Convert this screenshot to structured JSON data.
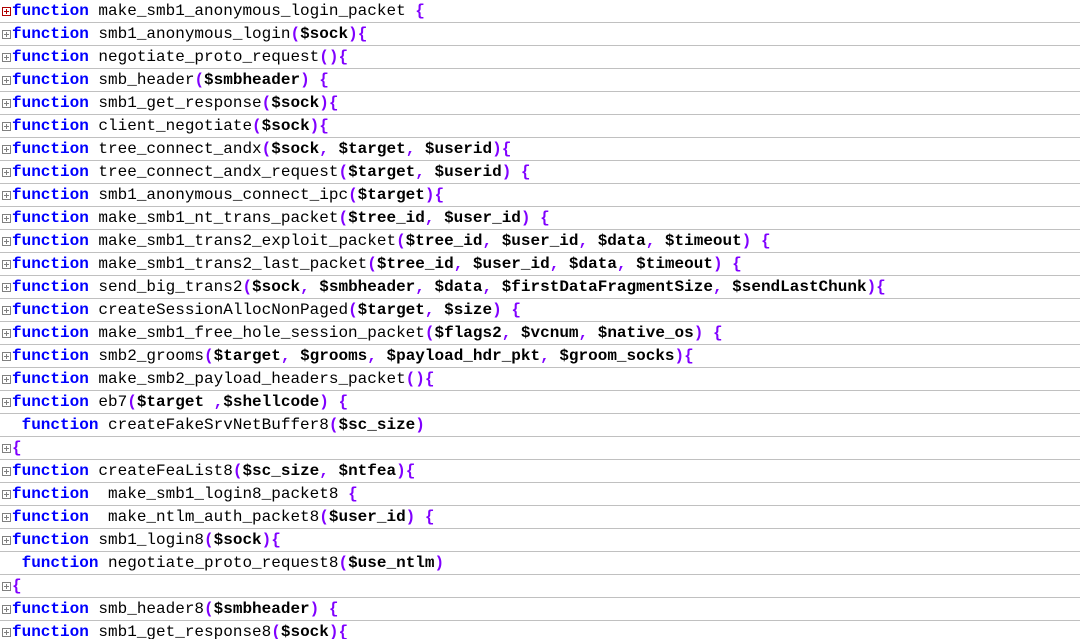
{
  "lines": [
    {
      "fold": "red",
      "tokens": [
        {
          "cls": "kw",
          "t": "function"
        },
        {
          "cls": "name",
          "t": " make_smb1_anonymous_login_packet "
        },
        {
          "cls": "brace",
          "t": "{"
        }
      ]
    },
    {
      "fold": "gray",
      "tokens": [
        {
          "cls": "kw",
          "t": "function"
        },
        {
          "cls": "name",
          "t": " smb1_anonymous_login"
        },
        {
          "cls": "punct",
          "t": "("
        },
        {
          "cls": "var",
          "t": "$sock"
        },
        {
          "cls": "punct",
          "t": ")"
        },
        {
          "cls": "brace",
          "t": "{"
        }
      ]
    },
    {
      "fold": "gray",
      "tokens": [
        {
          "cls": "kw",
          "t": "function"
        },
        {
          "cls": "name",
          "t": " negotiate_proto_request"
        },
        {
          "cls": "punct",
          "t": "()"
        },
        {
          "cls": "brace",
          "t": "{"
        }
      ]
    },
    {
      "fold": "gray",
      "tokens": [
        {
          "cls": "kw",
          "t": "function"
        },
        {
          "cls": "name",
          "t": " smb_header"
        },
        {
          "cls": "punct",
          "t": "("
        },
        {
          "cls": "var",
          "t": "$smbheader"
        },
        {
          "cls": "punct",
          "t": ") "
        },
        {
          "cls": "brace",
          "t": "{"
        }
      ]
    },
    {
      "fold": "gray",
      "tokens": [
        {
          "cls": "kw",
          "t": "function"
        },
        {
          "cls": "name",
          "t": " smb1_get_response"
        },
        {
          "cls": "punct",
          "t": "("
        },
        {
          "cls": "var",
          "t": "$sock"
        },
        {
          "cls": "punct",
          "t": ")"
        },
        {
          "cls": "brace",
          "t": "{"
        }
      ]
    },
    {
      "fold": "gray",
      "tokens": [
        {
          "cls": "kw",
          "t": "function"
        },
        {
          "cls": "name",
          "t": " client_negotiate"
        },
        {
          "cls": "punct",
          "t": "("
        },
        {
          "cls": "var",
          "t": "$sock"
        },
        {
          "cls": "punct",
          "t": ")"
        },
        {
          "cls": "brace",
          "t": "{"
        }
      ]
    },
    {
      "fold": "gray",
      "tokens": [
        {
          "cls": "kw",
          "t": "function"
        },
        {
          "cls": "name",
          "t": " tree_connect_andx"
        },
        {
          "cls": "punct",
          "t": "("
        },
        {
          "cls": "var",
          "t": "$sock"
        },
        {
          "cls": "punct",
          "t": ", "
        },
        {
          "cls": "var",
          "t": "$target"
        },
        {
          "cls": "punct",
          "t": ", "
        },
        {
          "cls": "var",
          "t": "$userid"
        },
        {
          "cls": "punct",
          "t": ")"
        },
        {
          "cls": "brace",
          "t": "{"
        }
      ]
    },
    {
      "fold": "gray",
      "tokens": [
        {
          "cls": "kw",
          "t": "function"
        },
        {
          "cls": "name",
          "t": " tree_connect_andx_request"
        },
        {
          "cls": "punct",
          "t": "("
        },
        {
          "cls": "var",
          "t": "$target"
        },
        {
          "cls": "punct",
          "t": ", "
        },
        {
          "cls": "var",
          "t": "$userid"
        },
        {
          "cls": "punct",
          "t": ") "
        },
        {
          "cls": "brace",
          "t": "{"
        }
      ]
    },
    {
      "fold": "gray",
      "tokens": [
        {
          "cls": "kw",
          "t": "function"
        },
        {
          "cls": "name",
          "t": " smb1_anonymous_connect_ipc"
        },
        {
          "cls": "punct",
          "t": "("
        },
        {
          "cls": "var",
          "t": "$target"
        },
        {
          "cls": "punct",
          "t": ")"
        },
        {
          "cls": "brace",
          "t": "{"
        }
      ]
    },
    {
      "fold": "gray",
      "tokens": [
        {
          "cls": "kw",
          "t": "function"
        },
        {
          "cls": "name",
          "t": " make_smb1_nt_trans_packet"
        },
        {
          "cls": "punct",
          "t": "("
        },
        {
          "cls": "var",
          "t": "$tree_id"
        },
        {
          "cls": "punct",
          "t": ", "
        },
        {
          "cls": "var",
          "t": "$user_id"
        },
        {
          "cls": "punct",
          "t": ") "
        },
        {
          "cls": "brace",
          "t": "{"
        }
      ]
    },
    {
      "fold": "gray",
      "tokens": [
        {
          "cls": "kw",
          "t": "function"
        },
        {
          "cls": "name",
          "t": " make_smb1_trans2_exploit_packet"
        },
        {
          "cls": "punct",
          "t": "("
        },
        {
          "cls": "var",
          "t": "$tree_id"
        },
        {
          "cls": "punct",
          "t": ", "
        },
        {
          "cls": "var",
          "t": "$user_id"
        },
        {
          "cls": "punct",
          "t": ", "
        },
        {
          "cls": "var",
          "t": "$data"
        },
        {
          "cls": "punct",
          "t": ", "
        },
        {
          "cls": "var",
          "t": "$timeout"
        },
        {
          "cls": "punct",
          "t": ") "
        },
        {
          "cls": "brace",
          "t": "{"
        }
      ]
    },
    {
      "fold": "gray",
      "tokens": [
        {
          "cls": "kw",
          "t": "function"
        },
        {
          "cls": "name",
          "t": " make_smb1_trans2_last_packet"
        },
        {
          "cls": "punct",
          "t": "("
        },
        {
          "cls": "var",
          "t": "$tree_id"
        },
        {
          "cls": "punct",
          "t": ", "
        },
        {
          "cls": "var",
          "t": "$user_id"
        },
        {
          "cls": "punct",
          "t": ", "
        },
        {
          "cls": "var",
          "t": "$data"
        },
        {
          "cls": "punct",
          "t": ", "
        },
        {
          "cls": "var",
          "t": "$timeout"
        },
        {
          "cls": "punct",
          "t": ") "
        },
        {
          "cls": "brace",
          "t": "{"
        }
      ]
    },
    {
      "fold": "gray",
      "tokens": [
        {
          "cls": "kw",
          "t": "function"
        },
        {
          "cls": "name",
          "t": " send_big_trans2"
        },
        {
          "cls": "punct",
          "t": "("
        },
        {
          "cls": "var",
          "t": "$sock"
        },
        {
          "cls": "punct",
          "t": ", "
        },
        {
          "cls": "var",
          "t": "$smbheader"
        },
        {
          "cls": "punct",
          "t": ", "
        },
        {
          "cls": "var",
          "t": "$data"
        },
        {
          "cls": "punct",
          "t": ", "
        },
        {
          "cls": "var",
          "t": "$firstDataFragmentSize"
        },
        {
          "cls": "punct",
          "t": ", "
        },
        {
          "cls": "var",
          "t": "$sendLastChunk"
        },
        {
          "cls": "punct",
          "t": ")"
        },
        {
          "cls": "brace",
          "t": "{"
        }
      ]
    },
    {
      "fold": "gray",
      "tokens": [
        {
          "cls": "kw",
          "t": "function"
        },
        {
          "cls": "name",
          "t": " createSessionAllocNonPaged"
        },
        {
          "cls": "punct",
          "t": "("
        },
        {
          "cls": "var",
          "t": "$target"
        },
        {
          "cls": "punct",
          "t": ", "
        },
        {
          "cls": "var",
          "t": "$size"
        },
        {
          "cls": "punct",
          "t": ") "
        },
        {
          "cls": "brace",
          "t": "{"
        }
      ]
    },
    {
      "fold": "gray",
      "tokens": [
        {
          "cls": "kw",
          "t": "function"
        },
        {
          "cls": "name",
          "t": " make_smb1_free_hole_session_packet"
        },
        {
          "cls": "punct",
          "t": "("
        },
        {
          "cls": "var",
          "t": "$flags2"
        },
        {
          "cls": "punct",
          "t": ", "
        },
        {
          "cls": "var",
          "t": "$vcnum"
        },
        {
          "cls": "punct",
          "t": ", "
        },
        {
          "cls": "var",
          "t": "$native_os"
        },
        {
          "cls": "punct",
          "t": ") "
        },
        {
          "cls": "brace",
          "t": "{"
        }
      ]
    },
    {
      "fold": "gray",
      "tokens": [
        {
          "cls": "kw",
          "t": "function"
        },
        {
          "cls": "name",
          "t": " smb2_grooms"
        },
        {
          "cls": "punct",
          "t": "("
        },
        {
          "cls": "var",
          "t": "$target"
        },
        {
          "cls": "punct",
          "t": ", "
        },
        {
          "cls": "var",
          "t": "$grooms"
        },
        {
          "cls": "punct",
          "t": ", "
        },
        {
          "cls": "var",
          "t": "$payload_hdr_pkt"
        },
        {
          "cls": "punct",
          "t": ", "
        },
        {
          "cls": "var",
          "t": "$groom_socks"
        },
        {
          "cls": "punct",
          "t": ")"
        },
        {
          "cls": "brace",
          "t": "{"
        }
      ]
    },
    {
      "fold": "gray",
      "tokens": [
        {
          "cls": "kw",
          "t": "function"
        },
        {
          "cls": "name",
          "t": " make_smb2_payload_headers_packet"
        },
        {
          "cls": "punct",
          "t": "()"
        },
        {
          "cls": "brace",
          "t": "{"
        }
      ]
    },
    {
      "fold": "gray",
      "tokens": [
        {
          "cls": "kw",
          "t": "function"
        },
        {
          "cls": "name",
          "t": " eb7"
        },
        {
          "cls": "punct",
          "t": "("
        },
        {
          "cls": "var",
          "t": "$target "
        },
        {
          "cls": "punct",
          "t": ","
        },
        {
          "cls": "var",
          "t": "$shellcode"
        },
        {
          "cls": "punct",
          "t": ") "
        },
        {
          "cls": "brace",
          "t": "{"
        }
      ]
    },
    {
      "fold": "none",
      "tokens": [
        {
          "cls": "kw",
          "t": " function"
        },
        {
          "cls": "name",
          "t": " createFakeSrvNetBuffer8"
        },
        {
          "cls": "punct",
          "t": "("
        },
        {
          "cls": "var",
          "t": "$sc_size"
        },
        {
          "cls": "punct",
          "t": ")"
        }
      ]
    },
    {
      "fold": "gray",
      "tokens": [
        {
          "cls": "brace",
          "t": "{"
        }
      ]
    },
    {
      "fold": "gray",
      "tokens": [
        {
          "cls": "kw",
          "t": "function"
        },
        {
          "cls": "name",
          "t": " createFeaList8"
        },
        {
          "cls": "punct",
          "t": "("
        },
        {
          "cls": "var",
          "t": "$sc_size"
        },
        {
          "cls": "punct",
          "t": ", "
        },
        {
          "cls": "var",
          "t": "$ntfea"
        },
        {
          "cls": "punct",
          "t": ")"
        },
        {
          "cls": "brace",
          "t": "{"
        }
      ]
    },
    {
      "fold": "gray",
      "tokens": [
        {
          "cls": "kw",
          "t": "function"
        },
        {
          "cls": "name",
          "t": "  make_smb1_login8_packet8 "
        },
        {
          "cls": "brace",
          "t": "{"
        }
      ]
    },
    {
      "fold": "gray",
      "tokens": [
        {
          "cls": "kw",
          "t": "function"
        },
        {
          "cls": "name",
          "t": "  make_ntlm_auth_packet8"
        },
        {
          "cls": "punct",
          "t": "("
        },
        {
          "cls": "var",
          "t": "$user_id"
        },
        {
          "cls": "punct",
          "t": ") "
        },
        {
          "cls": "brace",
          "t": "{"
        }
      ]
    },
    {
      "fold": "gray",
      "tokens": [
        {
          "cls": "kw",
          "t": "function"
        },
        {
          "cls": "name",
          "t": " smb1_login8"
        },
        {
          "cls": "punct",
          "t": "("
        },
        {
          "cls": "var",
          "t": "$sock"
        },
        {
          "cls": "punct",
          "t": ")"
        },
        {
          "cls": "brace",
          "t": "{"
        }
      ]
    },
    {
      "fold": "none",
      "tokens": [
        {
          "cls": "kw",
          "t": " function"
        },
        {
          "cls": "name",
          "t": " negotiate_proto_request8"
        },
        {
          "cls": "punct",
          "t": "("
        },
        {
          "cls": "var",
          "t": "$use_ntlm"
        },
        {
          "cls": "punct",
          "t": ")"
        }
      ]
    },
    {
      "fold": "gray",
      "tokens": [
        {
          "cls": "brace",
          "t": "{"
        }
      ]
    },
    {
      "fold": "gray",
      "tokens": [
        {
          "cls": "kw",
          "t": "function"
        },
        {
          "cls": "name",
          "t": " smb_header8"
        },
        {
          "cls": "punct",
          "t": "("
        },
        {
          "cls": "var",
          "t": "$smbheader"
        },
        {
          "cls": "punct",
          "t": ") "
        },
        {
          "cls": "brace",
          "t": "{"
        }
      ]
    },
    {
      "fold": "gray",
      "tokens": [
        {
          "cls": "kw",
          "t": "function"
        },
        {
          "cls": "name",
          "t": " smb1_get_response8"
        },
        {
          "cls": "punct",
          "t": "("
        },
        {
          "cls": "var",
          "t": "$sock"
        },
        {
          "cls": "punct",
          "t": ")"
        },
        {
          "cls": "brace",
          "t": "{"
        }
      ]
    }
  ]
}
